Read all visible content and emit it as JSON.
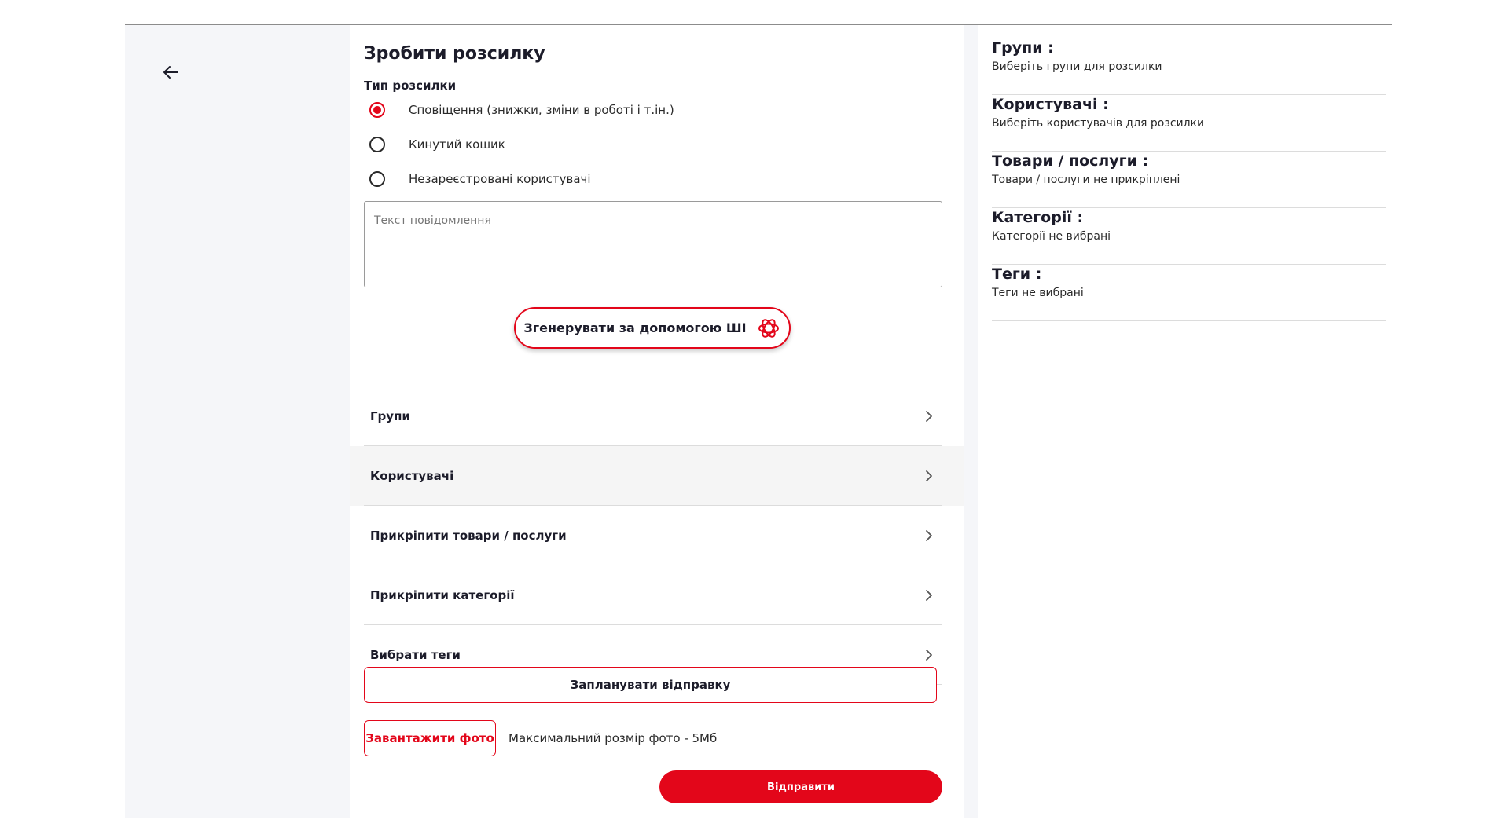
{
  "colors": {
    "accent": "#e3061a",
    "panel_bg": "#f5f6f9",
    "text": "#1c1c2a"
  },
  "left": {
    "back_icon": "arrow-left-icon"
  },
  "form": {
    "title": "Зробити розсилку",
    "type_label": "Тип розсилки",
    "options": [
      {
        "label": "Сповіщення (знижки, зміни в роботі і т.ін.)",
        "selected": true
      },
      {
        "label": "Кинутий кошик",
        "selected": false
      },
      {
        "label": "Незареєстровані користувачі",
        "selected": false
      }
    ],
    "message_placeholder": "Текст повідомлення",
    "ai_button": {
      "label": "Згенерувати за допомогою ШІ",
      "icon": "ai-spiral-icon"
    },
    "rows": [
      {
        "label": "Групи",
        "icon": "chevron-right-icon"
      },
      {
        "label": "Користувачі",
        "icon": "chevron-right-icon"
      },
      {
        "label": "Прикріпити товари / послуги",
        "icon": "chevron-right-icon"
      },
      {
        "label": "Прикріпити категорії",
        "icon": "chevron-right-icon"
      },
      {
        "label": "Вибрати теги",
        "icon": "chevron-right-icon"
      }
    ],
    "schedule_label": "Запланувати відправку",
    "upload_label": "Завантажити фото",
    "upload_note": "Максимальний розмір фото - 5Мб",
    "send_label": "Відправити"
  },
  "summary": [
    {
      "title": "Групи :",
      "value": "Виберіть групи для розсилки"
    },
    {
      "title": "Користувачі :",
      "value": "Виберіть користувачів для розсилки"
    },
    {
      "title": "Товари / послуги :",
      "value": "Товари / послуги не прикріплені"
    },
    {
      "title": "Категорії :",
      "value": "Категорії не вибрані"
    },
    {
      "title": "Теги :",
      "value": "Теги не вибрані"
    }
  ]
}
